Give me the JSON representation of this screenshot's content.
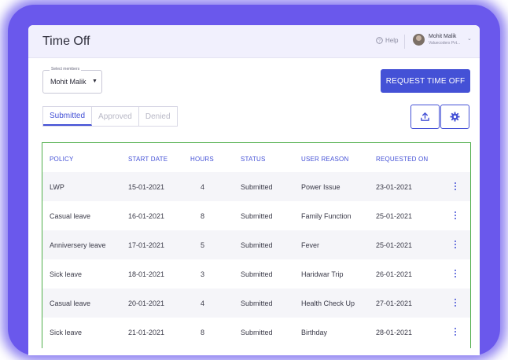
{
  "header": {
    "title": "Time Off",
    "help_label": "Help",
    "user_name": "Mohit Malik",
    "user_org": "Valuecoders Pvt..."
  },
  "filters": {
    "members_label": "Select members",
    "members_value": "Mohit Malik"
  },
  "actions": {
    "request_time_off": "REQUEST TIME OFF"
  },
  "tabs": [
    {
      "label": "Submitted",
      "active": true
    },
    {
      "label": "Approved",
      "active": false
    },
    {
      "label": "Denied",
      "active": false
    }
  ],
  "table": {
    "columns": [
      "POLICY",
      "START DATE",
      "HOURS",
      "STATUS",
      "USER REASON",
      "REQUESTED ON"
    ],
    "rows": [
      [
        "LWP",
        "15-01-2021",
        "4",
        "Submitted",
        "Power Issue",
        "23-01-2021"
      ],
      [
        "Casual leave",
        "16-01-2021",
        "8",
        "Submitted",
        "Family Function",
        "25-01-2021"
      ],
      [
        "Anniversery leave",
        "17-01-2021",
        "5",
        "Submitted",
        "Fever",
        "25-01-2021"
      ],
      [
        "Sick leave",
        "18-01-2021",
        "3",
        "Submitted",
        "Haridwar Trip",
        "26-01-2021"
      ],
      [
        "Casual leave",
        "20-01-2021",
        "4",
        "Submitted",
        "Health Check Up",
        "27-01-2021"
      ],
      [
        "Sick leave",
        "21-01-2021",
        "8",
        "Submitted",
        "Birthday",
        "28-01-2021"
      ]
    ]
  },
  "colors": {
    "accent": "#4451d6",
    "frame": "#6a58ec",
    "table_border": "#4fae4a"
  },
  "icons": [
    "help-icon",
    "chevron-down-icon",
    "upload-icon",
    "gear-icon",
    "more-vertical-icon"
  ]
}
